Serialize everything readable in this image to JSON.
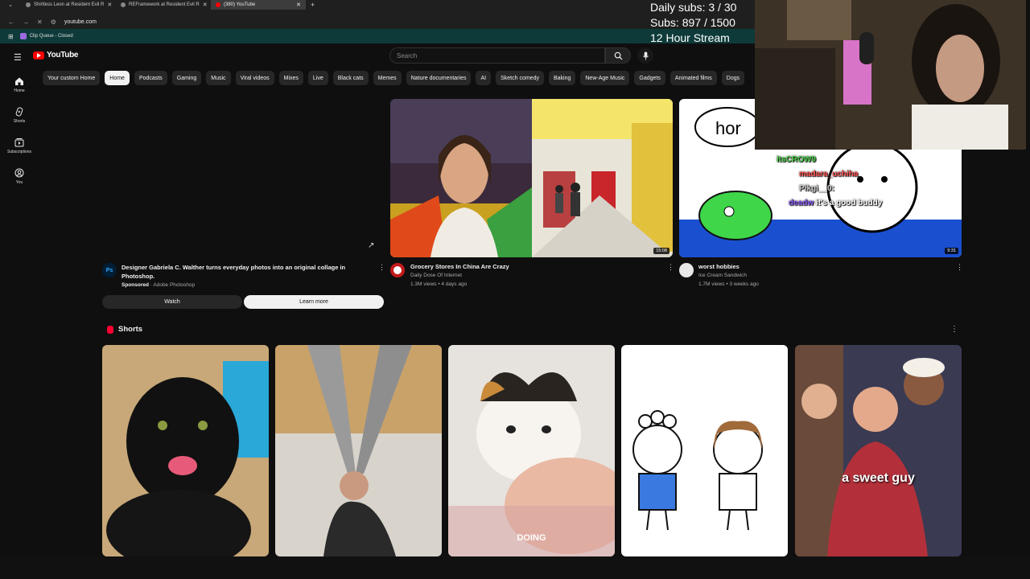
{
  "browser": {
    "tabs": [
      {
        "title": "Shirtless Leon at Resident Evil R",
        "active": false
      },
      {
        "title": "REFramework at Resident Evil R",
        "active": false
      },
      {
        "title": "(380) YouTube",
        "active": true
      }
    ],
    "url": "youtube.com",
    "bookmark": "Clip Queue - Closed"
  },
  "youtube": {
    "logo_text": "YouTube",
    "search_placeholder": "Search",
    "sidebar": [
      {
        "label": "Home",
        "icon": "home-icon"
      },
      {
        "label": "Shorts",
        "icon": "shorts-icon"
      },
      {
        "label": "Subscriptions",
        "icon": "subscriptions-icon"
      },
      {
        "label": "You",
        "icon": "you-icon"
      }
    ],
    "chips": [
      "Your custom Home",
      "Home",
      "Podcasts",
      "Gaming",
      "Music",
      "Viral videos",
      "Mixes",
      "Live",
      "Black cats",
      "Memes",
      "Nature documentaries",
      "AI",
      "Sketch comedy",
      "Baking",
      "New-Age Music",
      "Gadgets",
      "Animated films",
      "Dogs"
    ],
    "active_chip": "Home",
    "ad": {
      "logo": "Ps",
      "title": "Designer Gabriela C. Walther turns everyday photos into an original collage in Photoshop.",
      "sponsored": "Sponsored",
      "advertiser": "Adobe Photoshop",
      "watch_label": "Watch",
      "learn_label": "Learn more"
    },
    "videos": [
      {
        "title": "Grocery Stores In China Are Crazy",
        "channel": "Daily Dose Of Internet",
        "meta": "1.3M views • 4 days ago",
        "duration": "15:08"
      },
      {
        "title": "worst hobbies",
        "channel": "Ice Cream Sandwich",
        "meta": "1.7M views • 3 weeks ago",
        "duration": "9:31",
        "thumb_text": "hor"
      }
    ],
    "shorts_label": "Shorts",
    "shorts": [
      {
        "caption": ""
      },
      {
        "caption": ""
      },
      {
        "caption": "DOING"
      },
      {
        "caption": ""
      },
      {
        "caption": "a sweet guy"
      }
    ]
  },
  "stream_overlay": {
    "daily_subs": "Daily subs: 3 / 30",
    "subs": "Subs: 897 / 1500",
    "stream": "12 Hour Stream"
  },
  "chat": [
    {
      "name": "itsCROW9",
      "message": "",
      "color": "#4ad14a"
    },
    {
      "name": "madara_uchiha",
      "message": "",
      "color": "#ff4d4d"
    },
    {
      "name": "Pikgi__0:",
      "message": "",
      "color": "#cfcfcf"
    },
    {
      "name": "deadw",
      "message": "it's a good buddy",
      "color": "#8a5cf6"
    }
  ]
}
